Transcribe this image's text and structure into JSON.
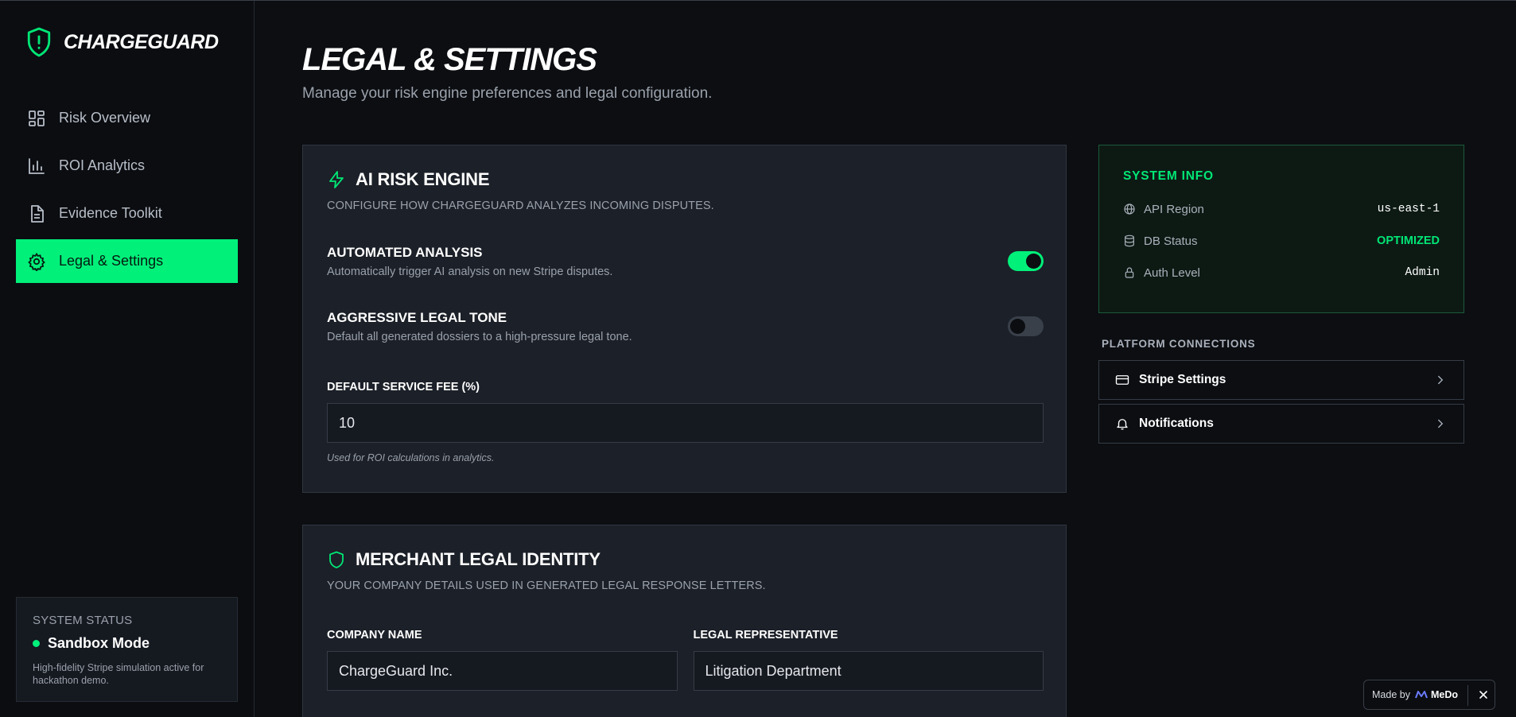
{
  "brand": {
    "name": "CHARGEGUARD"
  },
  "sidebar": {
    "items": [
      {
        "label": "Risk Overview",
        "icon": "grid-icon"
      },
      {
        "label": "ROI Analytics",
        "icon": "bar-chart-icon"
      },
      {
        "label": "Evidence Toolkit",
        "icon": "document-icon"
      },
      {
        "label": "Legal & Settings",
        "icon": "gear-icon",
        "active": true
      }
    ],
    "status": {
      "kicker": "SYSTEM STATUS",
      "mode": "Sandbox Mode",
      "description": "High-fidelity Stripe simulation active for hackathon demo."
    }
  },
  "page": {
    "title": "LEGAL & SETTINGS",
    "subtitle": "Manage your risk engine preferences and legal configuration."
  },
  "engine": {
    "title": "AI RISK ENGINE",
    "description": "CONFIGURE HOW CHARGEGUARD ANALYZES INCOMING DISPUTES.",
    "automated": {
      "title": "AUTOMATED ANALYSIS",
      "description": "Automatically trigger AI analysis on new Stripe disputes.",
      "enabled": true
    },
    "aggressive": {
      "title": "AGGRESSIVE LEGAL TONE",
      "description": "Default all generated dossiers to a high-pressure legal tone.",
      "enabled": false
    },
    "fee": {
      "label": "DEFAULT SERVICE FEE (%)",
      "value": "10",
      "help": "Used for ROI calculations in analytics."
    }
  },
  "identity": {
    "title": "MERCHANT LEGAL IDENTITY",
    "description": "YOUR COMPANY DETAILS USED IN GENERATED LEGAL RESPONSE LETTERS.",
    "company": {
      "label": "COMPANY NAME",
      "value": "ChargeGuard Inc."
    },
    "representative": {
      "label": "LEGAL REPRESENTATIVE",
      "value": "Litigation Department"
    }
  },
  "system_info": {
    "title": "SYSTEM INFO",
    "rows": [
      {
        "label": "API Region",
        "value": "us-east-1",
        "icon": "globe-icon"
      },
      {
        "label": "DB Status",
        "value": "OPTIMIZED",
        "icon": "database-icon"
      },
      {
        "label": "Auth Level",
        "value": "Admin",
        "icon": "lock-icon"
      }
    ]
  },
  "connections": {
    "title": "PLATFORM CONNECTIONS",
    "items": [
      {
        "label": "Stripe Settings",
        "icon": "credit-card-icon"
      },
      {
        "label": "Notifications",
        "icon": "bell-icon"
      }
    ]
  },
  "badge": {
    "prefix": "Made by",
    "brand": "MeDo"
  },
  "colors": {
    "accent": "#00f07a",
    "background": "#0c0e12",
    "card": "#1c2028"
  }
}
